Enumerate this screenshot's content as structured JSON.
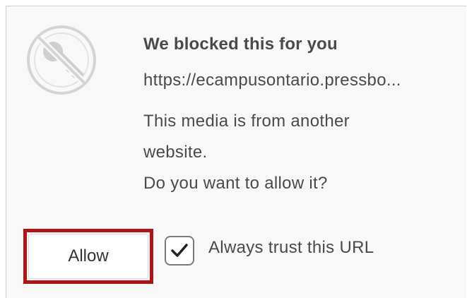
{
  "dialog": {
    "icon": "blocked-key-icon",
    "title": "We blocked this for you",
    "url": "https://ecampusontario.pressbo...",
    "message_line1": "This media is from another",
    "message_line2": "website.",
    "message_line3": "Do you want to allow it?",
    "allow_label": "Allow",
    "trust_label": "Always trust this URL",
    "trust_checked": true,
    "highlight_color": "#b01218"
  }
}
